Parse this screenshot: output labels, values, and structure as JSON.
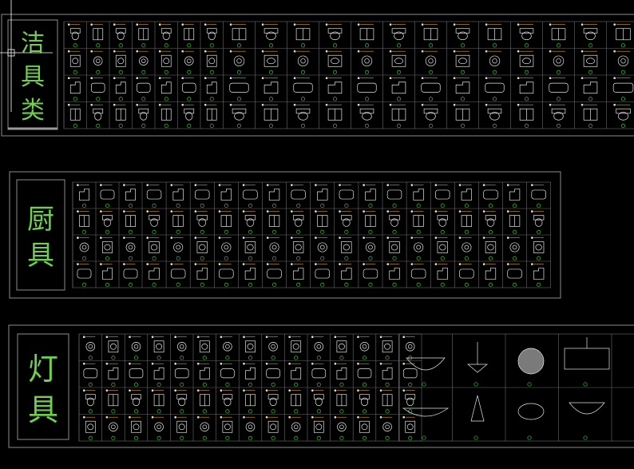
{
  "sections": [
    {
      "id": "sanitary",
      "label": "洁具类",
      "accent": "#6fcf4f"
    },
    {
      "id": "kitchen",
      "label": "厨具",
      "accent": "#6fcf4f"
    },
    {
      "id": "lighting",
      "label": "灯具",
      "accent": "#6fcf4f"
    }
  ],
  "colors": {
    "background": "#000000",
    "frame": "#8c8c8c",
    "grid": "#6c6c6c",
    "symbol": "#e6e6e6",
    "tag": "#39c239",
    "dimension": "#e0a030",
    "crosshair": "#ffffff"
  },
  "cursor": {
    "type": "crosshair"
  }
}
